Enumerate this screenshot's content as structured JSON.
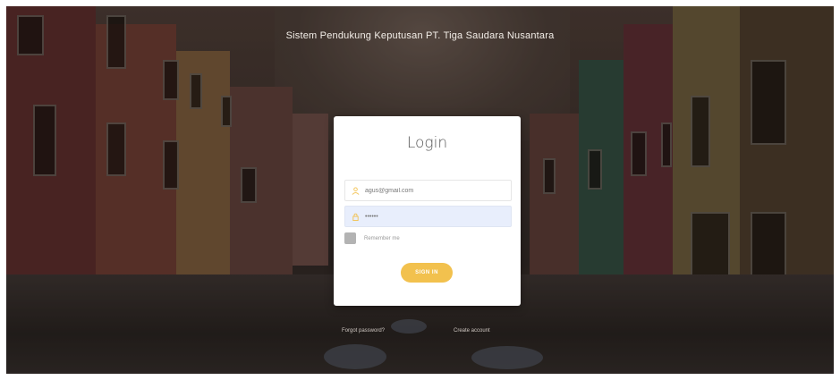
{
  "app": {
    "title": "Sistem Pendukung Keputusan PT. Tiga Saudara Nusantara"
  },
  "login": {
    "heading": "Login",
    "email": {
      "value": "agus@gmail.com",
      "icon": "user-icon"
    },
    "password": {
      "value": "••••••",
      "icon": "lock-icon"
    },
    "remember_label": "Remember me",
    "submit_label": "SIGN IN"
  },
  "footer": {
    "forgot_password": "Forgot password?",
    "create_account": "Create account"
  },
  "colors": {
    "accent": "#f2c14e",
    "card": "#ffffff",
    "password_field_bg": "#e8eefc"
  }
}
